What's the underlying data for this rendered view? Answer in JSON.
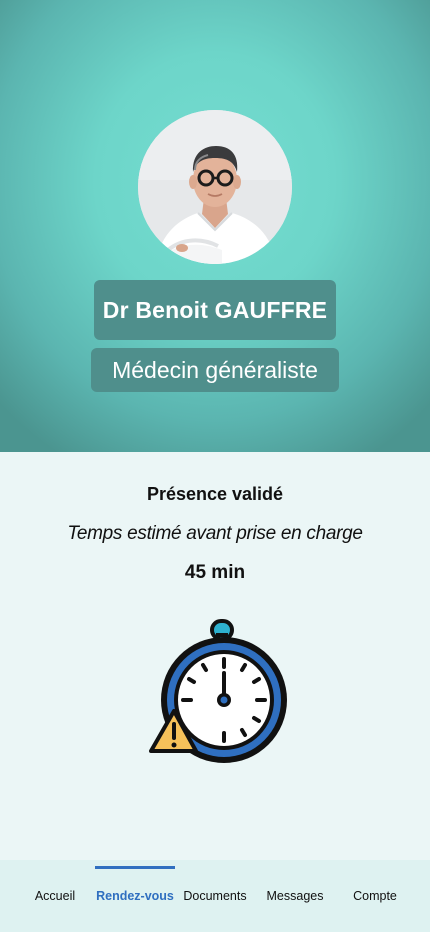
{
  "doctor": {
    "name": "Dr Benoit GAUFFRE",
    "specialty": "Médecin généraliste"
  },
  "status": {
    "title": "Présence validé",
    "wait_label": "Temps estimé avant prise en charge",
    "wait_value": "45 min"
  },
  "icons": {
    "avatar": "doctor-portrait",
    "illustration": "stopwatch-warning-icon"
  },
  "colors": {
    "hero": "#6dd5c9",
    "chip": "#4f8f8c",
    "accent": "#2f6fc0",
    "nav_background": "#def2f1"
  },
  "nav": {
    "items": [
      {
        "label": "Accueil"
      },
      {
        "label": "Rendez-vous"
      },
      {
        "label": "Documents"
      },
      {
        "label": "Messages"
      },
      {
        "label": "Compte"
      }
    ],
    "active": "Rendez-vous"
  }
}
